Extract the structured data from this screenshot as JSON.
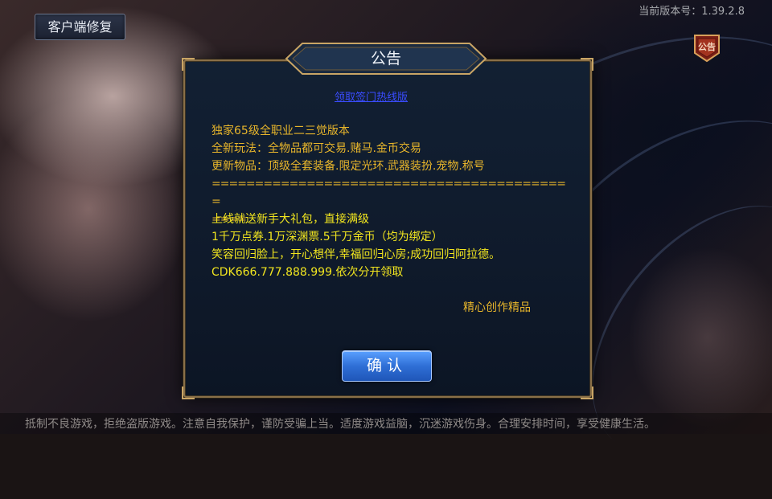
{
  "topbar": {
    "client_fix_label": "客户端修复",
    "version_text": "当前版本号：1.39.2.8",
    "notice_icon_label": "公告"
  },
  "dialog": {
    "title": "公告",
    "link_text": "领取签门热线版",
    "feature_lines": [
      "独家65级全职业二三觉版本",
      "全新玩法：全物品都可交易.赌马.金币交易",
      "更新物品：顶级全套装备.限定光环.武器装扮.宠物.称号"
    ],
    "divider_line": "==========================================",
    "divider_tail": "====",
    "gift_lines": [
      "上线就送新手大礼包，直接满级",
      "1千万点券.1万深渊票.5千万金币（均为绑定）",
      "笑容回归脸上，开心想伴,幸福回归心房;成功回归阿拉德。",
      "CDK666.777.888.999.依次分开领取"
    ],
    "signature": "精心创作精品",
    "confirm_label": "确认"
  },
  "footer": {
    "health_notice": "抵制不良游戏，拒绝盗版游戏。注意自我保护，谨防受骗上当。适度游戏益脑，沉迷游戏伤身。合理安排时间，享受健康生活。"
  },
  "colors": {
    "notice_text": "#e7b52b",
    "gift_text": "#f2e61f",
    "link": "#3a4cff",
    "confirm_button": "#2f6fd6"
  },
  "icons": {
    "notice": "notice-badge-icon"
  }
}
